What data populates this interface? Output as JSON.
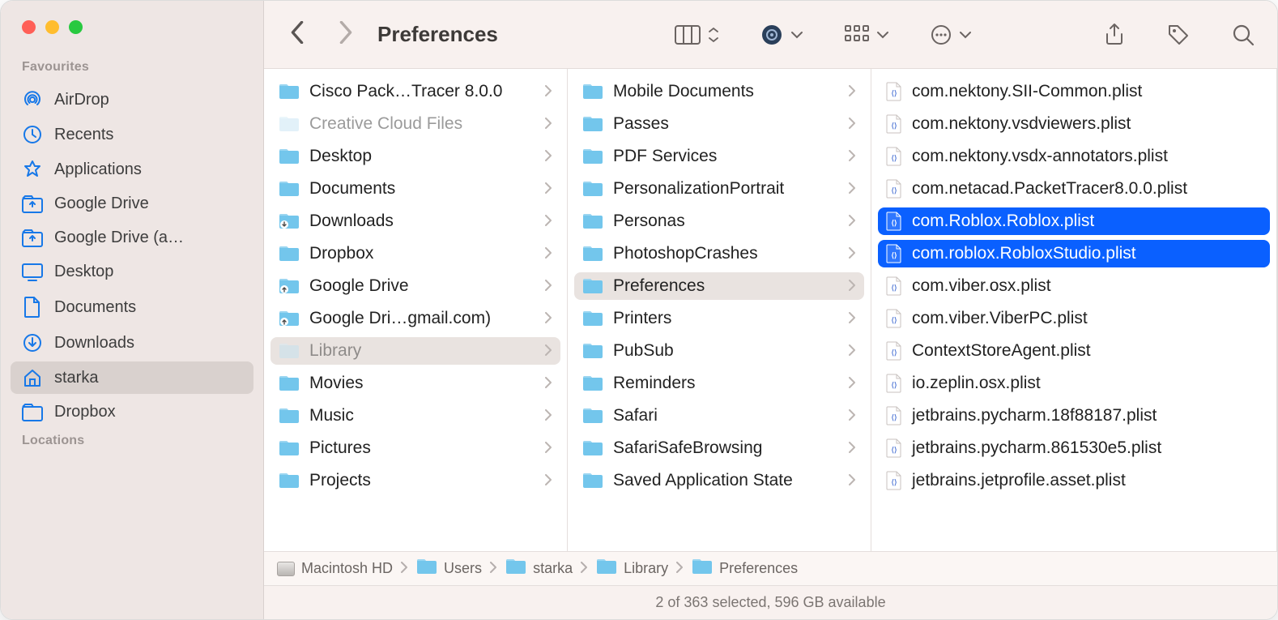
{
  "window": {
    "title": "Preferences"
  },
  "sidebar": {
    "sections": [
      {
        "heading": "Favourites",
        "items": [
          {
            "icon": "airdrop",
            "label": "AirDrop",
            "active": false
          },
          {
            "icon": "recents",
            "label": "Recents",
            "active": false
          },
          {
            "icon": "apps",
            "label": "Applications",
            "active": false
          },
          {
            "icon": "gdrive",
            "label": "Google Drive",
            "active": false
          },
          {
            "icon": "gdrive",
            "label": "Google Drive (a…",
            "active": false
          },
          {
            "icon": "desktop",
            "label": "Desktop",
            "active": false
          },
          {
            "icon": "doc",
            "label": "Documents",
            "active": false
          },
          {
            "icon": "download",
            "label": "Downloads",
            "active": false
          },
          {
            "icon": "home",
            "label": "starka",
            "active": true
          },
          {
            "icon": "dropbox",
            "label": "Dropbox",
            "active": false
          }
        ]
      },
      {
        "heading": "Locations",
        "items": []
      }
    ]
  },
  "columns": {
    "col1": [
      {
        "label": "Cisco Pack…Tracer 8.0.0",
        "dimmed": false,
        "sel": false
      },
      {
        "label": "Creative Cloud Files",
        "dimmed": true,
        "sel": false
      },
      {
        "label": "Desktop",
        "dimmed": false,
        "sel": false
      },
      {
        "label": "Documents",
        "dimmed": false,
        "sel": false
      },
      {
        "label": "Downloads",
        "dimmed": false,
        "sel": false,
        "badge": "down"
      },
      {
        "label": "Dropbox",
        "dimmed": false,
        "sel": false
      },
      {
        "label": "Google Drive",
        "dimmed": false,
        "sel": false,
        "badge": "up"
      },
      {
        "label": "Google Dri…gmail.com)",
        "dimmed": false,
        "sel": false,
        "badge": "up"
      },
      {
        "label": "Library",
        "dimmed": true,
        "sel": true
      },
      {
        "label": "Movies",
        "dimmed": false,
        "sel": false
      },
      {
        "label": "Music",
        "dimmed": false,
        "sel": false
      },
      {
        "label": "Pictures",
        "dimmed": false,
        "sel": false
      },
      {
        "label": "Projects",
        "dimmed": false,
        "sel": false
      }
    ],
    "col2": [
      {
        "label": "Mobile Documents",
        "sel": false
      },
      {
        "label": "Passes",
        "sel": false
      },
      {
        "label": "PDF Services",
        "sel": false
      },
      {
        "label": "PersonalizationPortrait",
        "sel": false
      },
      {
        "label": "Personas",
        "sel": false
      },
      {
        "label": "PhotoshopCrashes",
        "sel": false
      },
      {
        "label": "Preferences",
        "sel": true
      },
      {
        "label": "Printers",
        "sel": false
      },
      {
        "label": "PubSub",
        "sel": false
      },
      {
        "label": "Reminders",
        "sel": false
      },
      {
        "label": "Safari",
        "sel": false
      },
      {
        "label": "SafariSafeBrowsing",
        "sel": false
      },
      {
        "label": "Saved Application State",
        "sel": false
      }
    ],
    "col3": [
      {
        "label": "com.nektony.SII-Common.plist",
        "sel": false
      },
      {
        "label": "com.nektony.vsdviewers.plist",
        "sel": false
      },
      {
        "label": "com.nektony.vsdx-annotators.plist",
        "sel": false
      },
      {
        "label": "com.netacad.PacketTracer8.0.0.plist",
        "sel": false
      },
      {
        "label": "com.Roblox.Roblox.plist",
        "sel": true
      },
      {
        "label": "com.roblox.RobloxStudio.plist",
        "sel": true
      },
      {
        "label": "com.viber.osx.plist",
        "sel": false
      },
      {
        "label": "com.viber.ViberPC.plist",
        "sel": false
      },
      {
        "label": "ContextStoreAgent.plist",
        "sel": false
      },
      {
        "label": "io.zeplin.osx.plist",
        "sel": false
      },
      {
        "label": "jetbrains.pycharm.18f88187.plist",
        "sel": false
      },
      {
        "label": "jetbrains.pycharm.861530e5.plist",
        "sel": false
      },
      {
        "label": "jetbrains.jetprofile.asset.plist",
        "sel": false
      }
    ]
  },
  "pathbar": [
    {
      "icon": "hd",
      "label": "Macintosh HD"
    },
    {
      "icon": "folder",
      "label": "Users"
    },
    {
      "icon": "folder",
      "label": "starka"
    },
    {
      "icon": "folder",
      "label": "Library"
    },
    {
      "icon": "folder",
      "label": "Preferences"
    }
  ],
  "status": "2 of 363 selected, 596 GB available"
}
